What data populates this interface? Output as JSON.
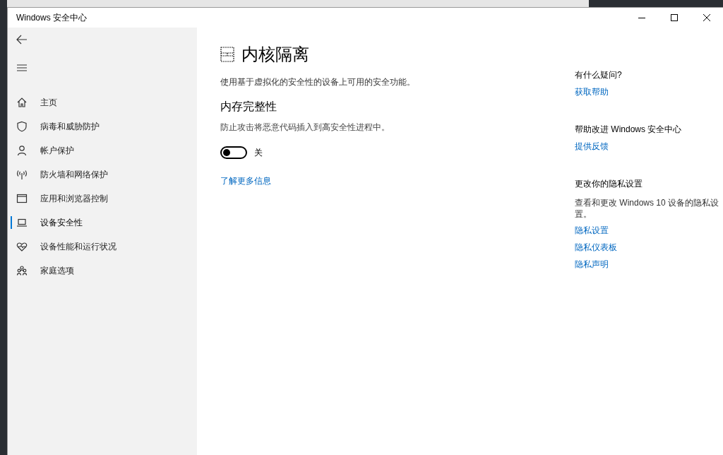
{
  "window": {
    "title": "Windows 安全中心"
  },
  "sidebar": {
    "items": [
      {
        "label": "主页",
        "kind": "home",
        "selected": false
      },
      {
        "label": "病毒和威胁防护",
        "kind": "shield",
        "selected": false
      },
      {
        "label": "帐户保护",
        "kind": "person",
        "selected": false
      },
      {
        "label": "防火墙和网络保护",
        "kind": "antenna",
        "selected": false
      },
      {
        "label": "应用和浏览器控制",
        "kind": "window",
        "selected": false
      },
      {
        "label": "设备安全性",
        "kind": "laptop",
        "selected": true
      },
      {
        "label": "设备性能和运行状况",
        "kind": "heart",
        "selected": false
      },
      {
        "label": "家庭选项",
        "kind": "family",
        "selected": false
      }
    ]
  },
  "main": {
    "title": "内核隔离",
    "description": "使用基于虚拟化的安全性的设备上可用的安全功能。",
    "section_title": "内存完整性",
    "section_description": "防止攻击将恶意代码插入到高安全性进程中。",
    "toggle": {
      "on": false,
      "label": "关"
    },
    "link": "了解更多信息"
  },
  "aside": [
    {
      "heading": "有什么疑问?",
      "links": [
        "获取帮助"
      ]
    },
    {
      "heading": "帮助改进 Windows 安全中心",
      "links": [
        "提供反馈"
      ]
    },
    {
      "heading": "更改你的隐私设置",
      "text": "查看和更改 Windows 10 设备的隐私设置。",
      "links": [
        "隐私设置",
        "隐私仪表板",
        "隐私声明"
      ]
    }
  ]
}
